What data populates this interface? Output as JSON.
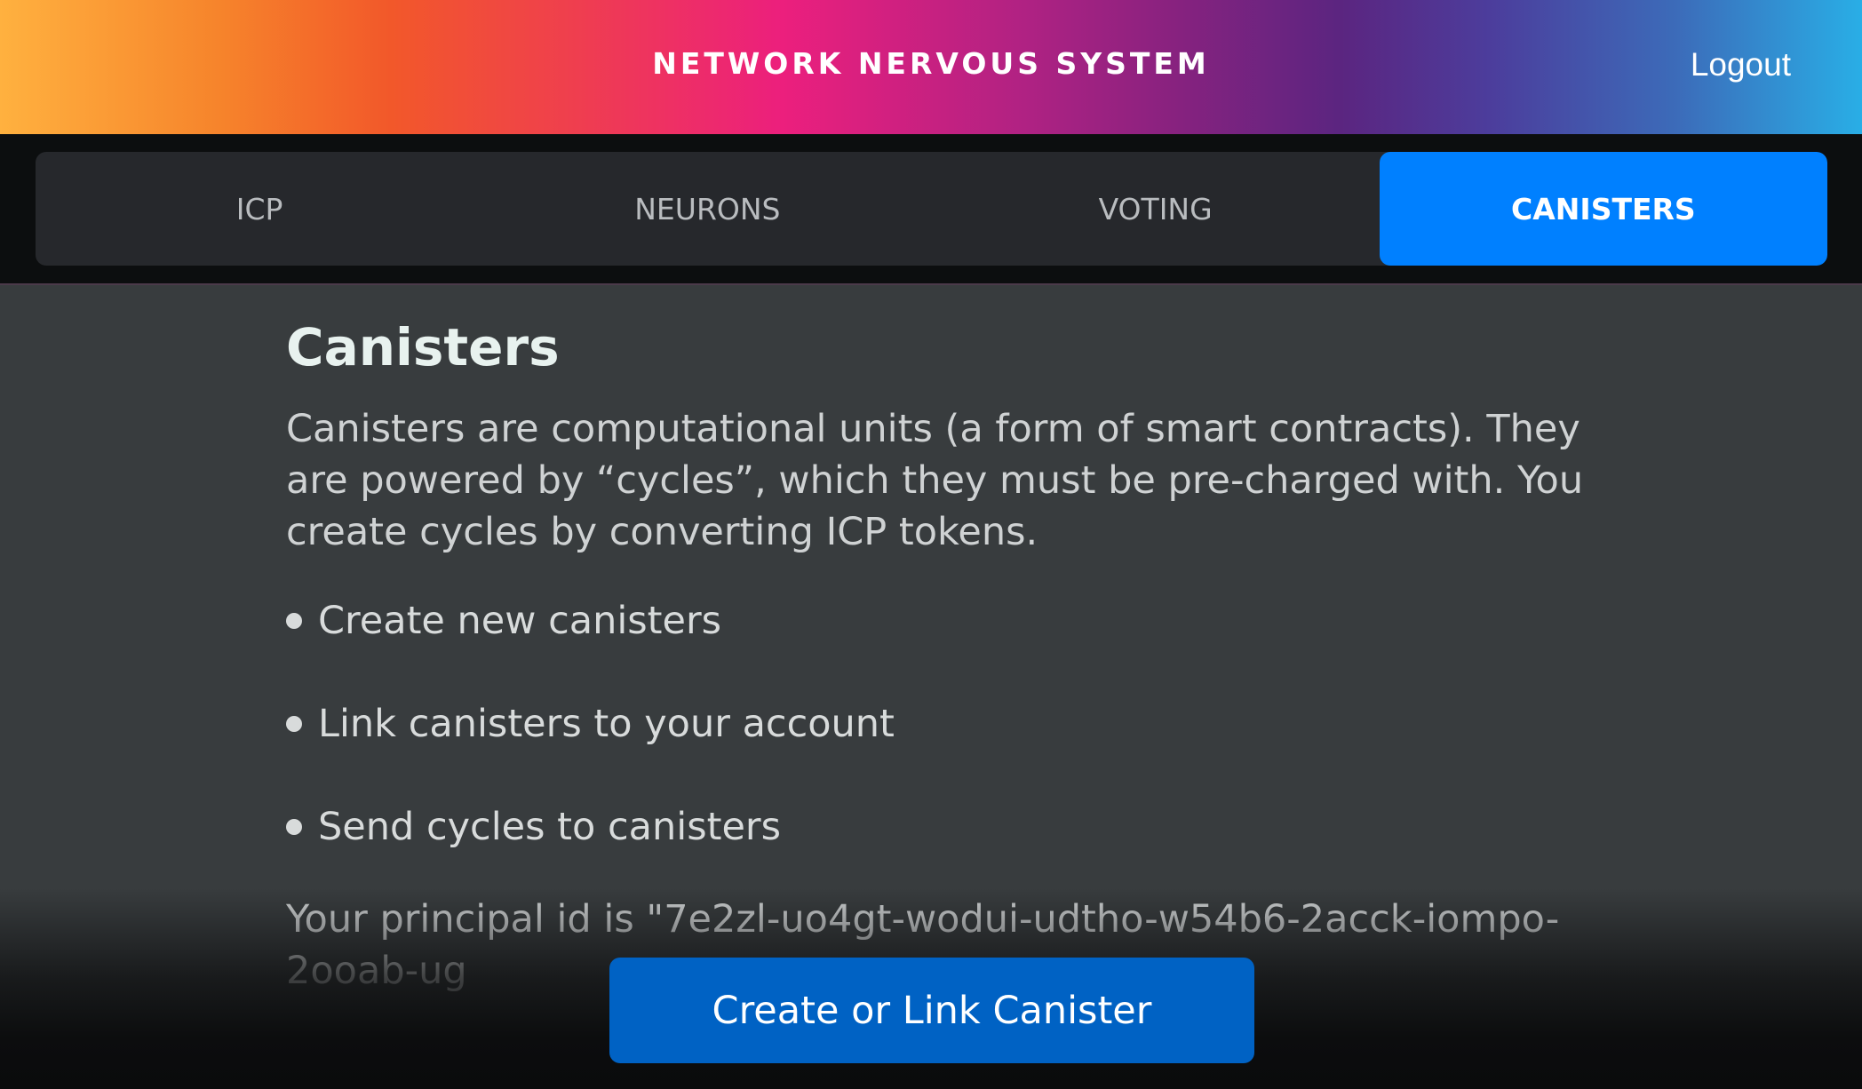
{
  "header": {
    "title": "NETWORK NERVOUS SYSTEM",
    "logout_label": "Logout"
  },
  "tabs": [
    {
      "label": "ICP",
      "active": false
    },
    {
      "label": "NEURONS",
      "active": false
    },
    {
      "label": "VOTING",
      "active": false
    },
    {
      "label": "CANISTERS",
      "active": true
    }
  ],
  "main": {
    "title": "Canisters",
    "description": "Canisters are computational units (a form of smart contracts). They are powered by “cycles”, which they must be pre-charged with. You create cycles by converting ICP tokens.",
    "features": [
      "Create new canisters",
      "Link canisters to your account",
      "Send cycles to canisters"
    ],
    "principal_text": "Your principal id is \"7e2zl-uo4gt-wodui-udtho-w54b6-2acck-iompo-2ooab-ug"
  },
  "actions": {
    "create_label": "Create or Link Canister"
  },
  "colors": {
    "active_tab": "#0080ff",
    "primary_button": "#0062c4",
    "background": "#383c3e"
  }
}
